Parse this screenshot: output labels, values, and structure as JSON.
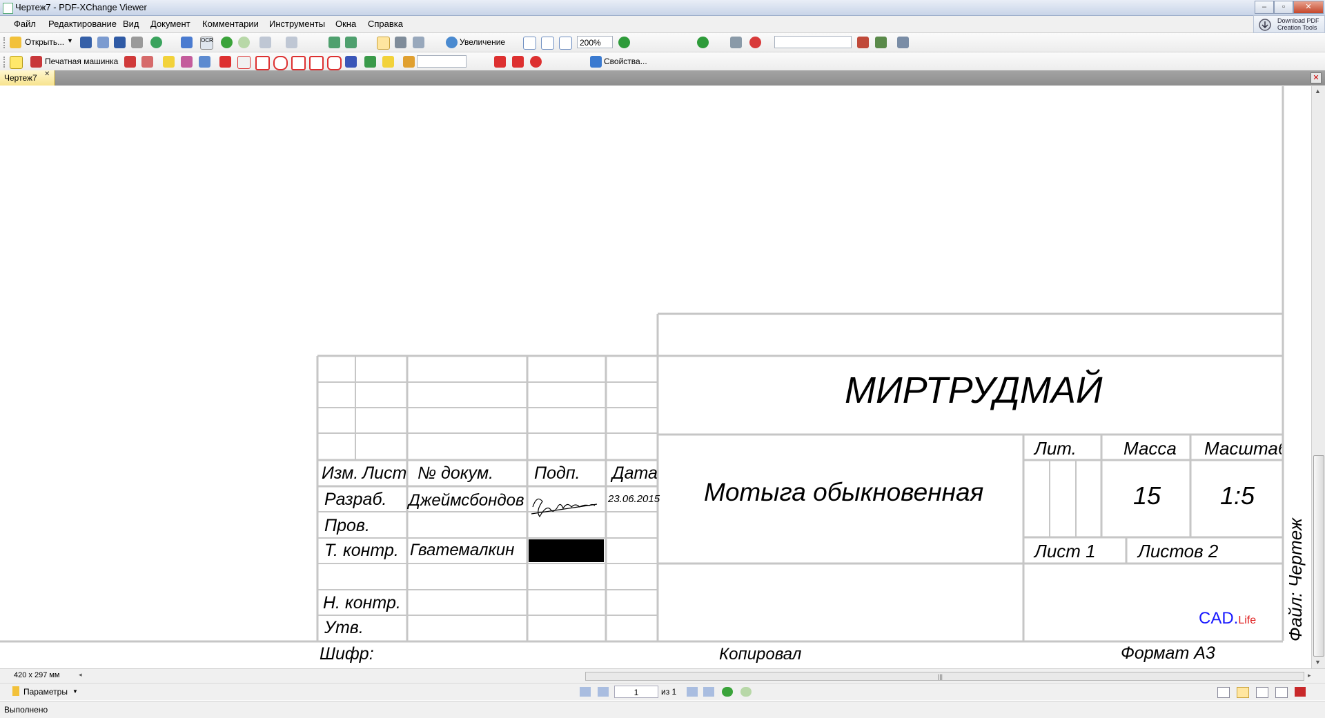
{
  "window": {
    "title": "Чертеж7 - PDF-XChange Viewer",
    "min_btn": "–",
    "max_btn": "▫",
    "close_btn": "✕"
  },
  "menu": [
    "Файл",
    "Редактирование",
    "Вид",
    "Документ",
    "Комментарии",
    "Инструменты",
    "Окна",
    "Справка"
  ],
  "download_button": {
    "line1": "Download PDF",
    "line2": "Creation Tools"
  },
  "toolbar1": {
    "open_label": "Открыть...",
    "zoom_label": "Увеличение",
    "zoom_value": "200%",
    "search_value": ""
  },
  "toolbar2": {
    "typewriter_label": "Печатная машинка",
    "props_label": "Свойства...",
    "font_value": ""
  },
  "tab": {
    "label": "Чертеж7",
    "close": "✕"
  },
  "drawing": {
    "company": "МИРТРУДМАЙ",
    "part_name": "Мотыга обыкновенная",
    "headers": {
      "izm": "Изм.",
      "list": "Лист",
      "doc": "№ докум.",
      "sign": "Подп.",
      "date": "Дата"
    },
    "rows": {
      "razrab": "Разраб.",
      "razrab_name": "Джеймсбондов",
      "razrab_date": "23.06.2015",
      "prov": "Пров.",
      "tkontr": "Т. контр.",
      "tkontr_name": "Гватемалкин",
      "nkontr": "Н. контр.",
      "utv": "Утв."
    },
    "lit_label": "Лит.",
    "mass_label": "Масса",
    "scale_label": "Масштаб",
    "mass_value": "15",
    "scale_value": "1:5",
    "sheet_label": "Лист 1",
    "sheets_label": "Листов 2",
    "cad_main": "CAD.",
    "cad_sub": "Life",
    "file_label": "Файл: Чертеж",
    "shifr_label": "Шифр:",
    "copied_label": "Копировал",
    "format_label": "Формат А3"
  },
  "status": {
    "page_size": "420 x 297 мм",
    "params_label": "Параметры",
    "page_number": "1",
    "page_of": "из 1",
    "done": "Выполнено"
  },
  "colors": {
    "grid_line": "#c6c6c6",
    "cad_blue": "#1a1aff",
    "cad_red": "#e02020"
  }
}
